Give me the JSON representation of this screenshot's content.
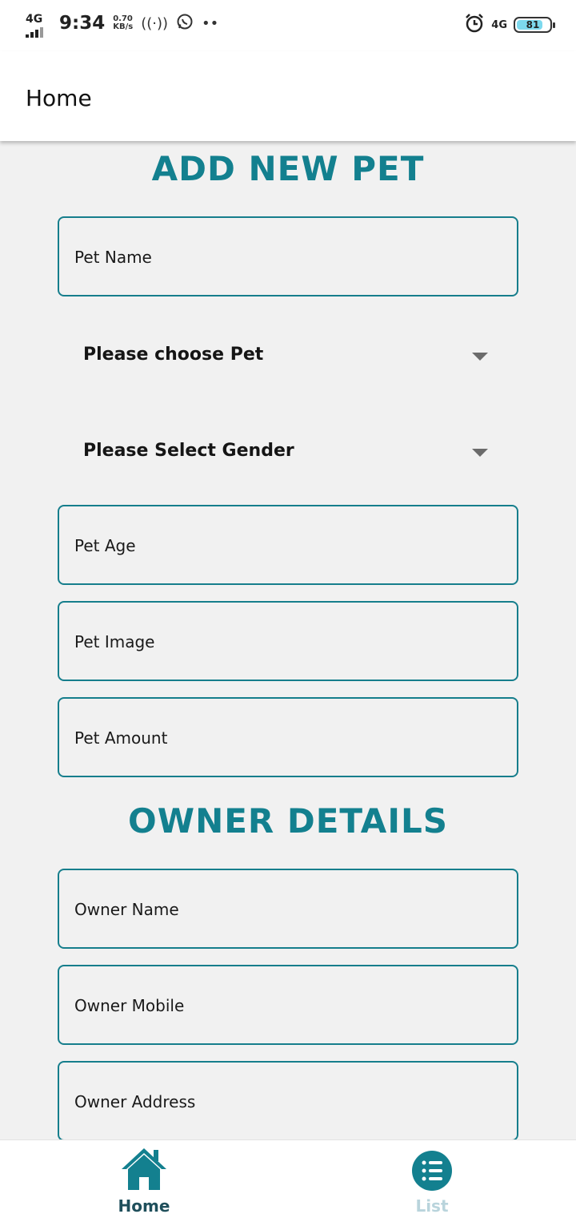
{
  "status_bar": {
    "network": "4G",
    "time": "9:34",
    "speed_value": "0.70",
    "speed_unit": "KB/s",
    "network_right": "4G",
    "battery_level": "81",
    "battery_fraction": 0.81
  },
  "app_bar": {
    "title": "Home"
  },
  "pet_section": {
    "title": "ADD NEW PET",
    "pet_name_label": "Pet Name",
    "pet_type_dropdown": "Please choose Pet",
    "gender_dropdown": "Please Select Gender",
    "pet_age_label": "Pet Age",
    "pet_image_label": "Pet Image",
    "pet_amount_label": "Pet Amount"
  },
  "owner_section": {
    "title": "OWNER DETAILS",
    "owner_name_label": "Owner Name",
    "owner_mobile_label": "Owner Mobile",
    "owner_address_label": "Owner Address"
  },
  "bottom_nav": {
    "home_label": "Home",
    "list_label": "List"
  },
  "colors": {
    "accent": "#13808f",
    "field_border": "#167e8c",
    "background": "#f1f1f1",
    "nav_active_label": "#1f4f5b",
    "nav_inactive_label": "#b9d4dc"
  },
  "icons": {
    "home": "home-icon",
    "list": "list-icon",
    "dropdown": "caret-down-icon"
  }
}
